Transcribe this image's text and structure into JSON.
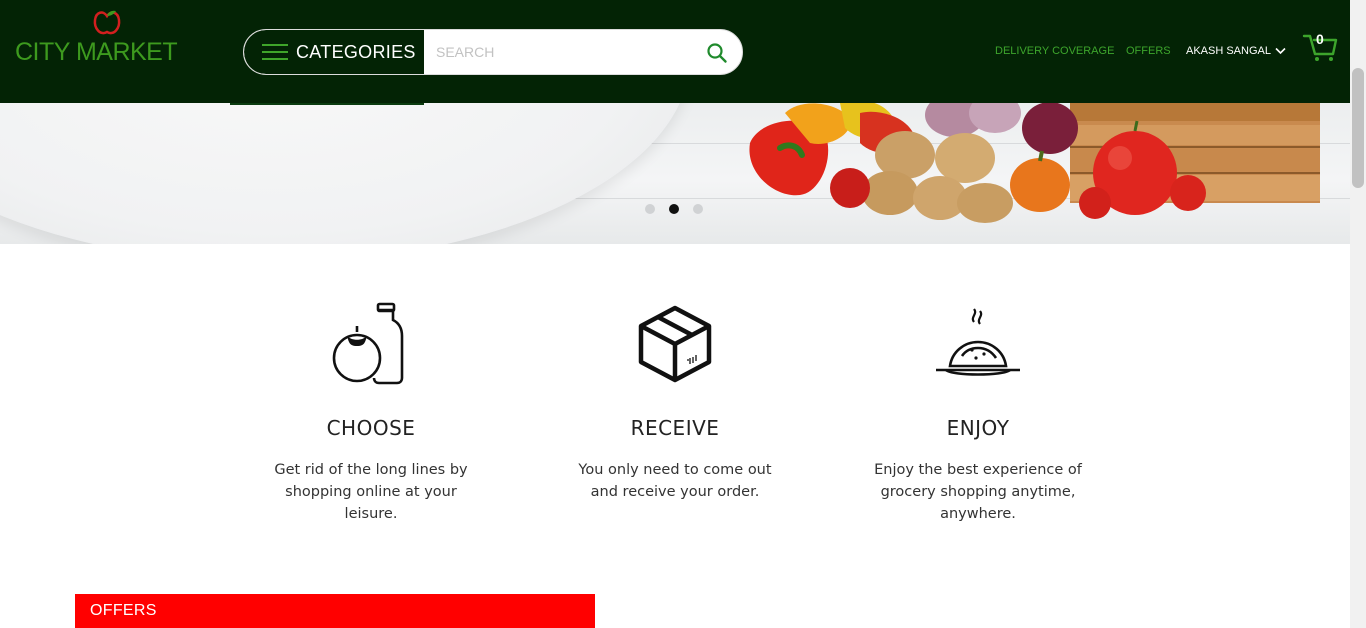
{
  "header": {
    "brand": "CITY MARKET",
    "categories_label": "CATEGORIES",
    "search_placeholder": "SEARCH",
    "nav": {
      "delivery": "DELIVERY COVERAGE",
      "offers": "OFFERS",
      "user": "AKASH SANGAL"
    },
    "cart_count": "0"
  },
  "carousel": {
    "slide_count": 3,
    "active_index": 1
  },
  "features": [
    {
      "title": "CHOOSE",
      "description": "Get rid of the long lines by shopping online at your leisure.",
      "icon": "tomato-bottle-icon"
    },
    {
      "title": "RECEIVE",
      "description": "You only need to come out and receive your order.",
      "icon": "package-box-icon"
    },
    {
      "title": "ENJOY",
      "description": "Enjoy the best experience of grocery shopping anytime, anywhere.",
      "icon": "hot-dish-icon"
    }
  ],
  "offers_section": {
    "title": "OFFERS"
  },
  "colors": {
    "header_bg": "#032305",
    "brand_green": "#3d9a1e",
    "offers_red": "#ff0000"
  }
}
